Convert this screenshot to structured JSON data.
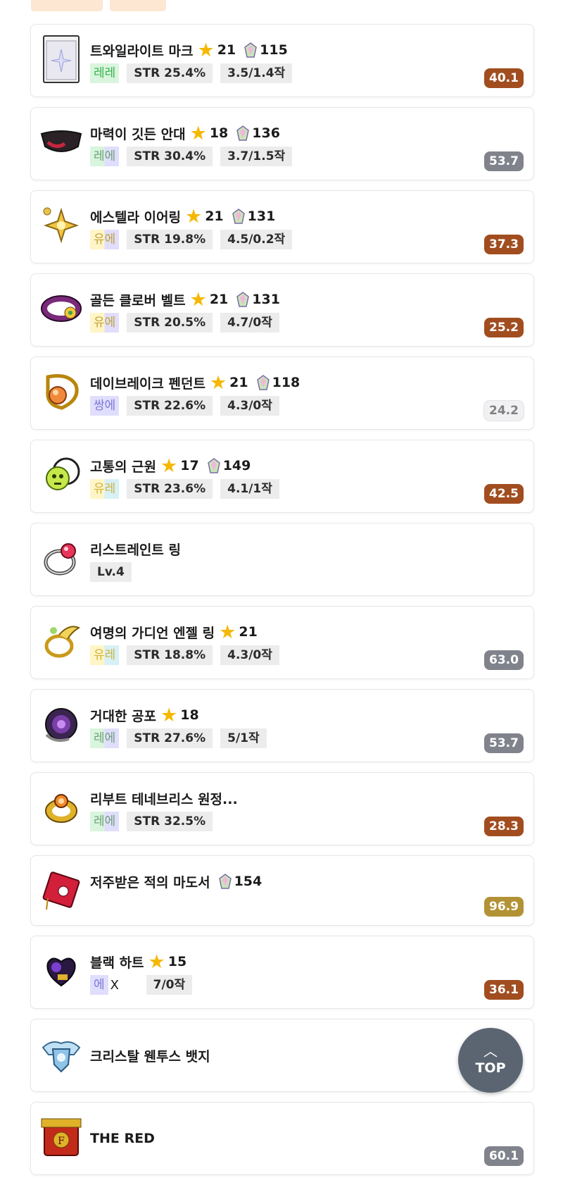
{
  "items": [
    {
      "name": "트와일라이트 마크",
      "star": "21",
      "gem": "115",
      "pot": "레레",
      "pot_class": "re-re",
      "tags": [
        "STR 25.4%",
        "3.5/1.4작"
      ],
      "score": "40.1",
      "score_class": "brown"
    },
    {
      "name": "마력이 깃든 안대",
      "star": "18",
      "gem": "136",
      "pot": "레에",
      "pot_class": "re-e",
      "tags": [
        "STR 30.4%",
        "3.7/1.5작"
      ],
      "score": "53.7",
      "score_class": "gray"
    },
    {
      "name": "에스텔라 이어링",
      "star": "21",
      "gem": "131",
      "pot": "유에",
      "pot_class": "yu-e",
      "tags": [
        "STR 19.8%",
        "4.5/0.2작"
      ],
      "score": "37.3",
      "score_class": "brown"
    },
    {
      "name": "골든 클로버 벨트",
      "star": "21",
      "gem": "131",
      "pot": "유에",
      "pot_class": "yu-e",
      "tags": [
        "STR 20.5%",
        "4.7/0작"
      ],
      "score": "25.2",
      "score_class": "brown"
    },
    {
      "name": "데이브레이크 펜던트",
      "star": "21",
      "gem": "118",
      "pot": "쌍에",
      "pot_class": "ssang",
      "tags": [
        "STR 22.6%",
        "4.3/0작"
      ],
      "score": "24.2",
      "score_class": "light"
    },
    {
      "name": "고통의 근원",
      "star": "17",
      "gem": "149",
      "pot": "유레",
      "pot_class": "yu-re",
      "tags": [
        "STR 23.6%",
        "4.1/1작"
      ],
      "score": "42.5",
      "score_class": "brown"
    },
    {
      "name": "리스트레인트 링",
      "level": "Lv.4"
    },
    {
      "name": "여명의 가디언 엔젤 링",
      "star": "21",
      "pot": "유레",
      "pot_class": "yu-re",
      "tags": [
        "STR 18.8%",
        "4.3/0작"
      ],
      "score": "63.0",
      "score_class": "gray"
    },
    {
      "name": "거대한 공포",
      "star": "18",
      "pot": "레에",
      "pot_class": "re-e",
      "tags": [
        "STR 27.6%",
        "5/1작"
      ],
      "score": "53.7",
      "score_class": "gray"
    },
    {
      "name": "리부트 테네브리스 원정...",
      "pot": "레에",
      "pot_class": "re-e",
      "tags": [
        "STR 32.5%"
      ],
      "score": "28.3",
      "score_class": "brown"
    },
    {
      "name": "저주받은 적의 마도서",
      "gem": "154",
      "score": "96.9",
      "score_class": "gold"
    },
    {
      "name": "블랙 하트",
      "star": "15",
      "pot": "에",
      "pot_class": "e-only",
      "xmark": "X",
      "tags": [
        "7/0작"
      ],
      "score": "36.1",
      "score_class": "brown"
    },
    {
      "name": "크리스탈 웬투스 뱃지"
    },
    {
      "name": "THE RED",
      "score": "60.1",
      "score_class": "gray"
    }
  ],
  "top_button": {
    "label": "TOP",
    "icon": "chevron-up-icon"
  },
  "icons": [
    "twilight-mark-icon",
    "magic-eyepatch-icon",
    "estella-earring-icon",
    "golden-clover-belt-icon",
    "daybreak-pendant-icon",
    "source-of-suffering-icon",
    "restraint-ring-icon",
    "guardian-angel-ring-icon",
    "giant-fear-icon",
    "tenebris-ring-icon",
    "cursed-spellbook-icon",
    "black-heart-icon",
    "crystal-ventus-badge-icon",
    "the-red-icon"
  ]
}
